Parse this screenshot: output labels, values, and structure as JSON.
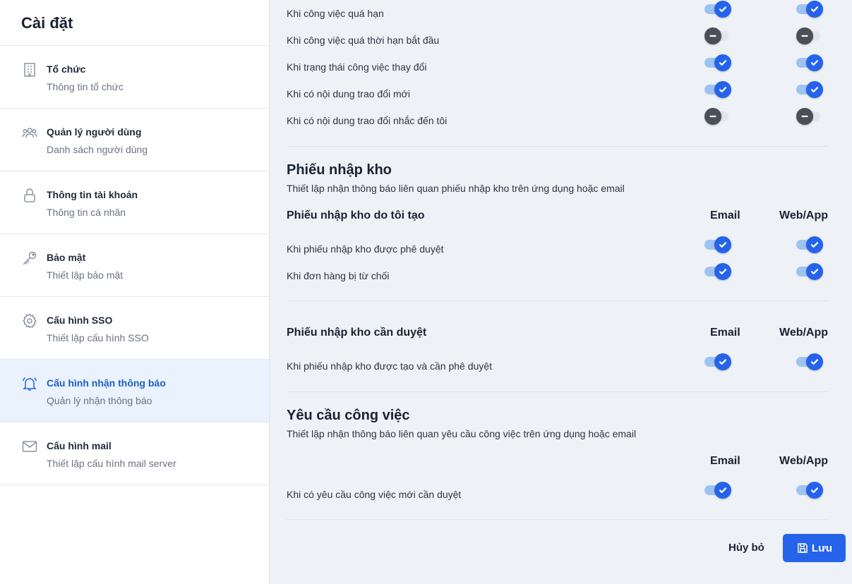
{
  "sidebar": {
    "title": "Cài đặt",
    "items": [
      {
        "label": "Tổ chức",
        "sub": "Thông tin tổ chức",
        "icon": "building-icon"
      },
      {
        "label": "Quản lý người dùng",
        "sub": "Danh sách người dùng",
        "icon": "users-icon"
      },
      {
        "label": "Thông tin tài khoản",
        "sub": "Thông tin cá nhân",
        "icon": "lock-icon"
      },
      {
        "label": "Bảo mật",
        "sub": "Thiết lập bảo mật",
        "icon": "key-icon"
      },
      {
        "label": "Cấu hình SSO",
        "sub": "Thiết lập cấu hình SSO",
        "icon": "gear-icon"
      },
      {
        "label": "Cấu hình nhận thông báo",
        "sub": "Quản lý nhận thông báo",
        "icon": "bell-icon",
        "active": true
      },
      {
        "label": "Cấu hình mail",
        "sub": "Thiết lập cấu hình mail server",
        "icon": "mail-icon"
      }
    ]
  },
  "top_rows": [
    {
      "label": "Khi công việc quá hạn",
      "email": true,
      "web": true
    },
    {
      "label": "Khi công việc quá thời hạn bắt đầu",
      "email": false,
      "web": false
    },
    {
      "label": "Khi trạng thái công việc thay đổi",
      "email": true,
      "web": true
    },
    {
      "label": "Khi có nội dung trao đổi mới",
      "email": true,
      "web": true
    },
    {
      "label": "Khi có nội dung trao đổi nhắc đến tôi",
      "email": false,
      "web": false
    }
  ],
  "columns": {
    "email": "Email",
    "web": "Web/App"
  },
  "warehouse": {
    "title": "Phiếu nhập kho",
    "desc": "Thiết lập nhận thông báo liên quan phiếu nhập kho trên ứng dụng hoặc email",
    "group1": {
      "title": "Phiếu nhập kho do tôi tạo",
      "rows": [
        {
          "label": "Khi phiếu nhập kho được phê duyệt",
          "email": true,
          "web": true
        },
        {
          "label": "Khi đơn hàng bị từ chối",
          "email": true,
          "web": true
        }
      ]
    },
    "group2": {
      "title": "Phiếu nhập kho cần duyệt",
      "rows": [
        {
          "label": "Khi phiếu nhập kho được tạo và cần phê duyệt",
          "email": true,
          "web": true
        }
      ]
    }
  },
  "work_request": {
    "title": "Yêu cầu công việc",
    "desc": "Thiết lập nhận thông báo liên quan yêu cầu công việc trên ứng dụng hoặc email",
    "rows": [
      {
        "label": "Khi có yêu cầu công việc mới cần duyệt",
        "email": true,
        "web": true
      }
    ]
  },
  "actions": {
    "cancel": "Hủy bỏ",
    "save": "Lưu"
  },
  "colors": {
    "accent": "#2563eb",
    "active_bg": "#eaf2fd",
    "active_text": "#1f5fc4"
  }
}
